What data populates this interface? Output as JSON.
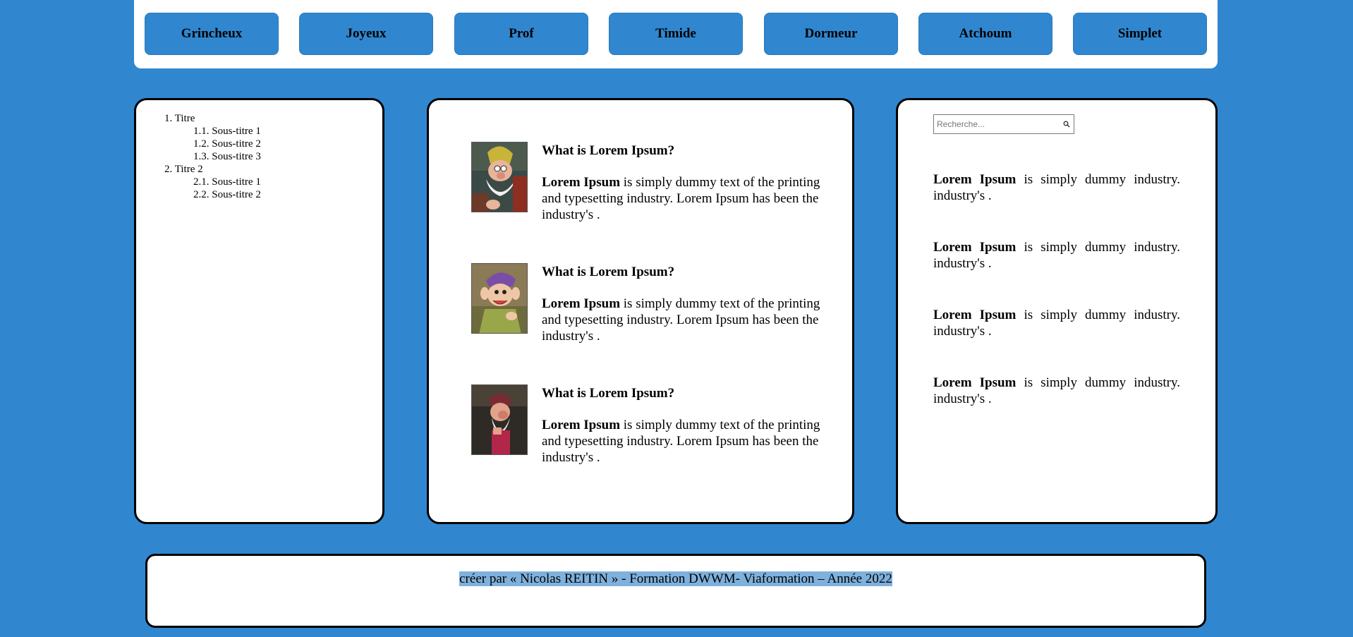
{
  "nav": {
    "items": [
      "Grincheux",
      "Joyeux",
      "Prof",
      "Timide",
      "Dormeur",
      "Atchoum",
      "Simplet"
    ]
  },
  "toc": {
    "items": [
      {
        "number": "1.",
        "label": "Titre",
        "children": [
          {
            "number": "1.1.",
            "label": "Sous-titre 1"
          },
          {
            "number": "1.2.",
            "label": "Sous-titre 2"
          },
          {
            "number": "1.3.",
            "label": "Sous-titre 3"
          }
        ]
      },
      {
        "number": "2.",
        "label": "Titre 2",
        "children": [
          {
            "number": "2.1.",
            "label": "Sous-titre 1"
          },
          {
            "number": "2.2.",
            "label": "Sous-titre 2"
          }
        ]
      }
    ]
  },
  "articles": [
    {
      "image": "dwarf-portrait-doc",
      "title": "What is Lorem Ipsum?",
      "bold": "Lorem Ipsum",
      "text": " is simply dummy text of the printing and typesetting industry. Lorem Ipsum has been the industry's ."
    },
    {
      "image": "dwarf-portrait-dopey",
      "title": "What is Lorem Ipsum?",
      "bold": "Lorem Ipsum",
      "text": " is simply dummy text of the printing and typesetting industry. Lorem Ipsum has been the industry's ."
    },
    {
      "image": "dwarf-portrait-grumpy",
      "title": "What is Lorem Ipsum?",
      "bold": "Lorem Ipsum",
      "text": " is simply dummy text of the printing and typesetting industry. Lorem Ipsum has been the industry's ."
    }
  ],
  "search": {
    "placeholder": "Recherche...",
    "icon": "search-icon"
  },
  "sidebar": {
    "items": [
      {
        "bold": "Lorem Ipsum",
        "text": " is simply dummy industry. industry's ."
      },
      {
        "bold": "Lorem Ipsum",
        "text": " is simply dummy industry. industry's ."
      },
      {
        "bold": "Lorem Ipsum",
        "text": " is simply dummy industry. industry's ."
      },
      {
        "bold": "Lorem Ipsum",
        "text": " is simply dummy industry. industry's ."
      }
    ]
  },
  "footer": {
    "text": "créer par « Nicolas REITIN » - Formation DWWM- Viaformation – Année 2022"
  },
  "colors": {
    "background": "#3087d0",
    "button": "#3087d0",
    "selection": "#7fb1dd"
  }
}
